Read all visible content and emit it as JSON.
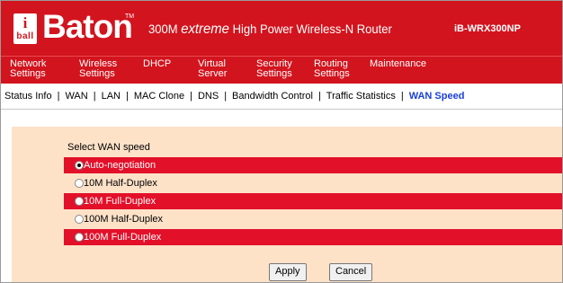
{
  "header": {
    "logo_i": "i",
    "logo_ball": "ball",
    "brand": "Baton",
    "brand_tm": "TM",
    "tagline_pre": "300M ",
    "tagline_ex": "extreme",
    "tagline_post": " High Power Wireless-N Router",
    "model": "iB-WRX300NP",
    "colors": {
      "header_red": "#d2141e",
      "option_red": "#e3102a",
      "content_bg": "#fde2c8",
      "active_link": "#1a3fd6"
    }
  },
  "main_nav": [
    {
      "line1": "Network",
      "line2": "Settings"
    },
    {
      "line1": "Wireless",
      "line2": "Settings"
    },
    {
      "line1": "DHCP",
      "line2": ""
    },
    {
      "line1": "Virtual",
      "line2": "Server"
    },
    {
      "line1": "Security",
      "line2": "Settings"
    },
    {
      "line1": "Routing",
      "line2": "Settings"
    },
    {
      "line1": "Maintenance",
      "line2": ""
    }
  ],
  "sub_nav": {
    "items": [
      "Status Info",
      "WAN",
      "LAN",
      "MAC Clone",
      "DNS",
      "Bandwidth Control",
      "Traffic Statistics",
      "WAN Speed"
    ],
    "separator": "|",
    "active": "WAN Speed"
  },
  "content": {
    "title": "Select WAN speed",
    "options": [
      {
        "label": "Auto-negotiation",
        "selected": true
      },
      {
        "label": "10M Half-Duplex",
        "selected": false
      },
      {
        "label": "10M Full-Duplex",
        "selected": false
      },
      {
        "label": "100M Half-Duplex",
        "selected": false
      },
      {
        "label": "100M Full-Duplex",
        "selected": false
      }
    ],
    "apply_label": "Apply",
    "cancel_label": "Cancel"
  }
}
